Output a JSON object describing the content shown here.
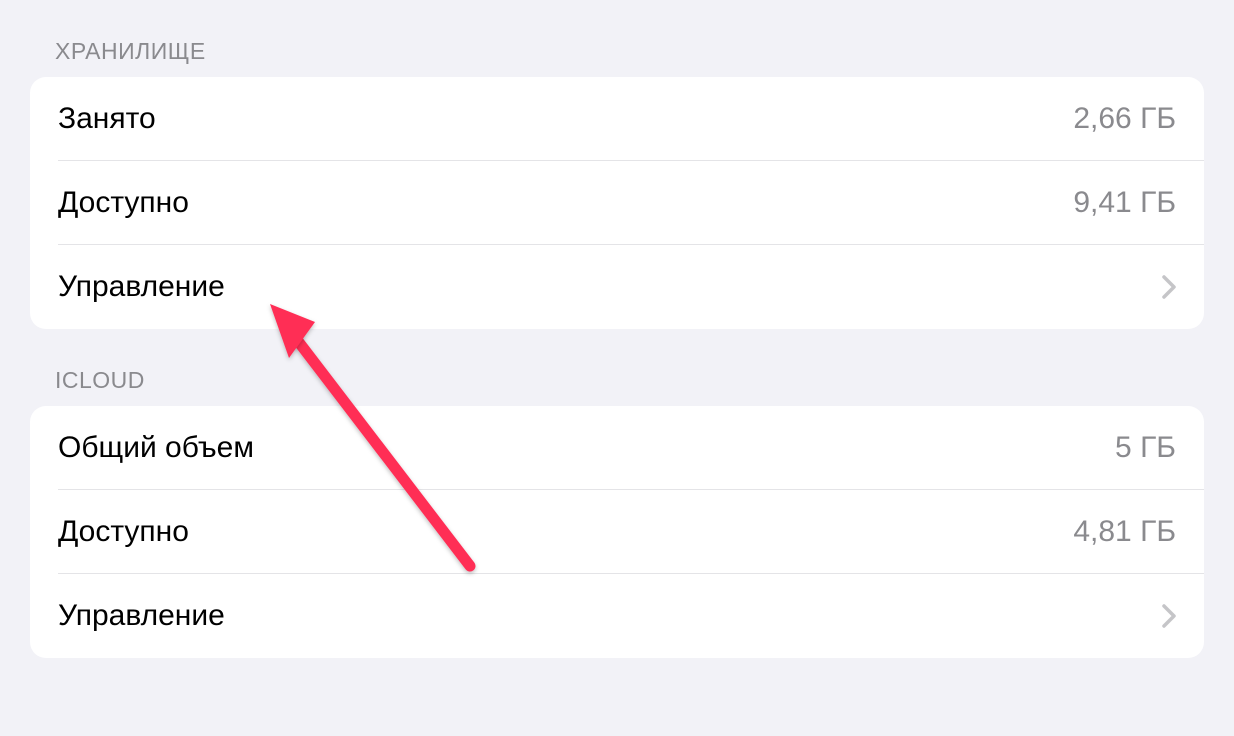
{
  "sections": {
    "storage": {
      "header": "ХРАНИЛИЩЕ",
      "rows": {
        "used": {
          "label": "Занято",
          "value": "2,66 ГБ"
        },
        "available": {
          "label": "Доступно",
          "value": "9,41 ГБ"
        },
        "manage": {
          "label": "Управление"
        }
      }
    },
    "icloud": {
      "header": "ICLOUD",
      "rows": {
        "total": {
          "label": "Общий объем",
          "value": "5 ГБ"
        },
        "available": {
          "label": "Доступно",
          "value": "4,81 ГБ"
        },
        "manage": {
          "label": "Управление"
        }
      }
    }
  },
  "colors": {
    "background": "#f2f2f7",
    "cellBackground": "#ffffff",
    "primaryText": "#000000",
    "secondaryText": "#8a8a8e",
    "separator": "#e4e4e7",
    "annotation": "#ff2d55"
  }
}
